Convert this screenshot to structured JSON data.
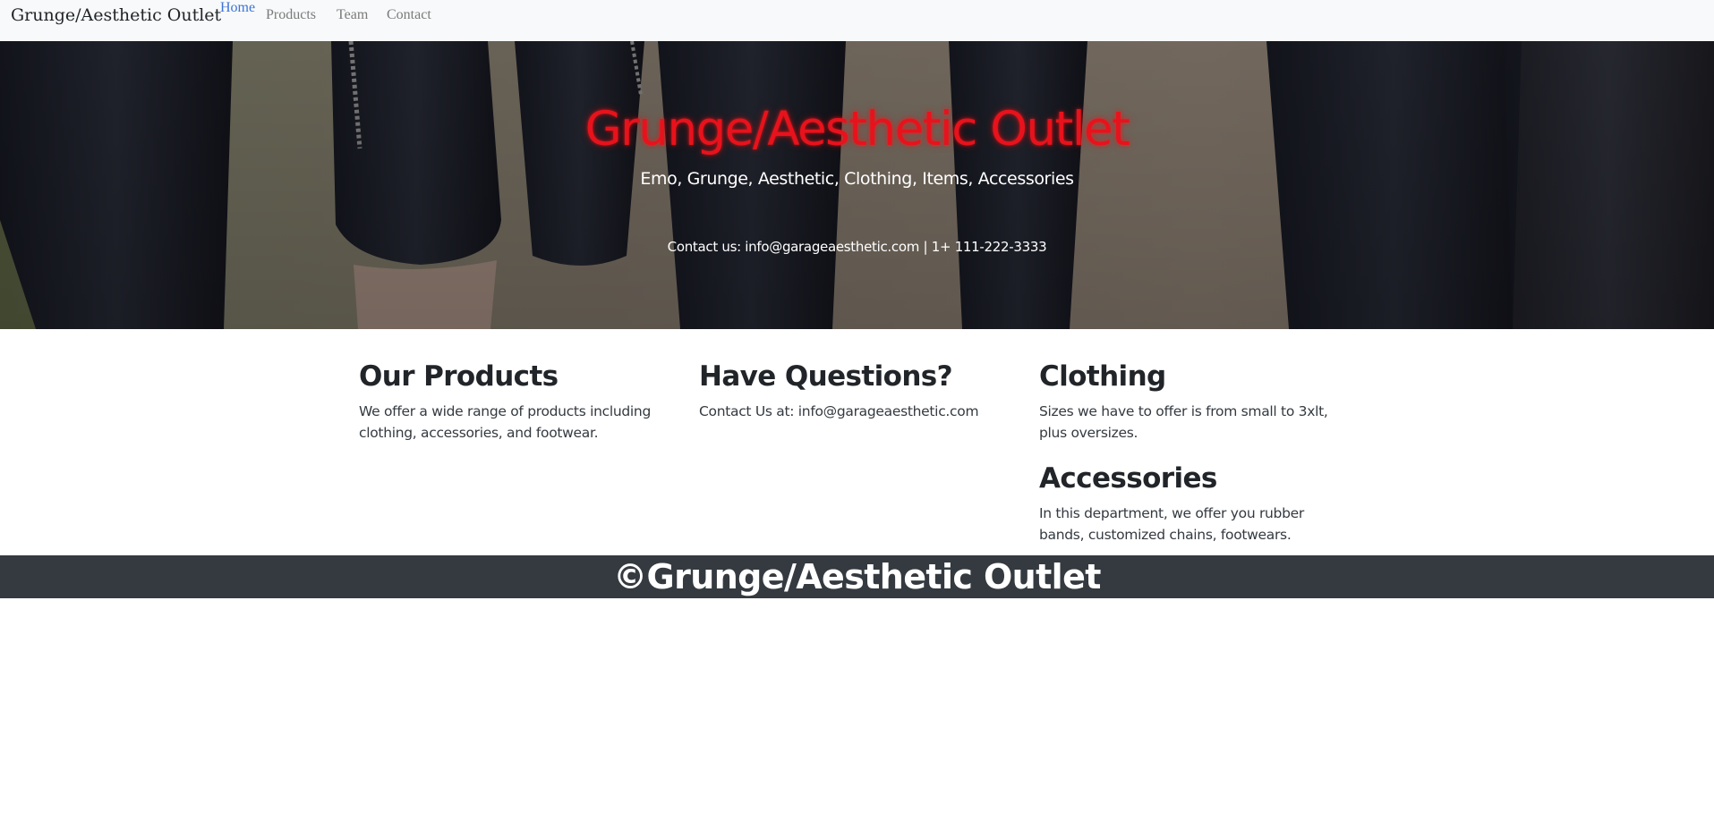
{
  "nav": {
    "brand": "Grunge/Aesthetic Outlet",
    "links": [
      {
        "label": "Home",
        "active": true
      },
      {
        "label": "Products",
        "active": false
      },
      {
        "label": "Team",
        "active": false
      },
      {
        "label": "Contact",
        "active": false
      }
    ]
  },
  "hero": {
    "title": "Grunge/Aesthetic Outlet",
    "subtitle": "Emo, Grunge, Aesthetic, Clothing, Items, Accessories",
    "contact": "Contact us: info@garageaesthetic.com | 1+ 111-222-3333",
    "image_icon": "hero-photo-legs-in-black-jeans"
  },
  "sections": {
    "products": {
      "heading": "Our Products",
      "body": "We offer a wide range of products including clothing, accessories, and footwear."
    },
    "questions": {
      "heading": "Have Questions?",
      "body": "Contact Us at: info@garageaesthetic.com"
    },
    "clothing": {
      "heading": "Clothing",
      "body": "Sizes we have to offer is from small to 3xlt, plus oversizes."
    },
    "accessories": {
      "heading": "Accessories",
      "body": "In this department, we offer you rubber bands, customized chains, footwears."
    }
  },
  "footer": {
    "text": "©Grunge/Aesthetic Outlet"
  },
  "colors": {
    "navbar_bg": "#f8f9fa",
    "nav_active": "#3b73d9",
    "nav_inactive": "#7a7a7a",
    "hero_title": "#e8121c",
    "footer_bg": "#343a40",
    "text_dark": "#212529"
  }
}
